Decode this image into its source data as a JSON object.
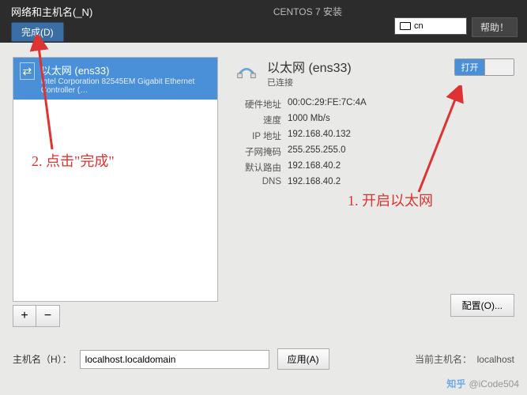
{
  "header": {
    "title": "网络和主机名(_N)",
    "done": "完成(D)",
    "installer": "CENTOS 7 安装",
    "lang": "cn",
    "help": "帮助！"
  },
  "device_list": {
    "item": {
      "title": "以太网 (ens33)",
      "subtitle": "Intel Corporation 82545EM Gigabit Ethernet Controller (…"
    },
    "add": "+",
    "remove": "−"
  },
  "device": {
    "name": "以太网 (ens33)",
    "status": "已连接",
    "switch_on": "打开",
    "details": {
      "mac_label": "硬件地址",
      "mac": "00:0C:29:FE:7C:4A",
      "speed_label": "速度",
      "speed": "1000 Mb/s",
      "ip_label": "IP 地址",
      "ip": "192.168.40.132",
      "mask_label": "子网掩码",
      "mask": "255.255.255.0",
      "route_label": "默认路由",
      "route": "192.168.40.2",
      "dns_label": "DNS",
      "dns": "192.168.40.2"
    },
    "configure": "配置(O)..."
  },
  "host": {
    "label": "主机名（H）：",
    "value": "localhost.localdomain",
    "apply": "应用(A)",
    "current_label": "当前主机名：",
    "current": "localhost"
  },
  "annotations": {
    "a1": "1. 开启以太网",
    "a2": "2. 点击\"完成\""
  },
  "watermark": "@iCode504"
}
